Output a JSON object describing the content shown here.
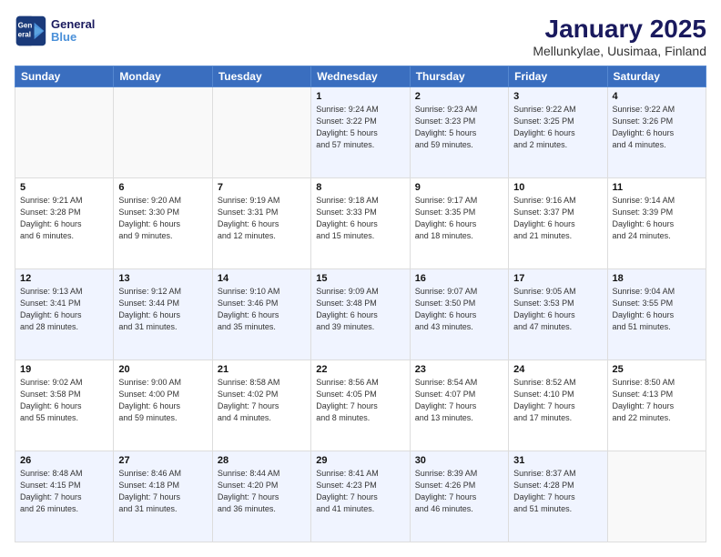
{
  "header": {
    "logo_line1": "General",
    "logo_line2": "Blue",
    "title": "January 2025",
    "subtitle": "Mellunkylae, Uusimaa, Finland"
  },
  "days_of_week": [
    "Sunday",
    "Monday",
    "Tuesday",
    "Wednesday",
    "Thursday",
    "Friday",
    "Saturday"
  ],
  "weeks": [
    [
      {
        "day": "",
        "info": ""
      },
      {
        "day": "",
        "info": ""
      },
      {
        "day": "",
        "info": ""
      },
      {
        "day": "1",
        "info": "Sunrise: 9:24 AM\nSunset: 3:22 PM\nDaylight: 5 hours\nand 57 minutes."
      },
      {
        "day": "2",
        "info": "Sunrise: 9:23 AM\nSunset: 3:23 PM\nDaylight: 5 hours\nand 59 minutes."
      },
      {
        "day": "3",
        "info": "Sunrise: 9:22 AM\nSunset: 3:25 PM\nDaylight: 6 hours\nand 2 minutes."
      },
      {
        "day": "4",
        "info": "Sunrise: 9:22 AM\nSunset: 3:26 PM\nDaylight: 6 hours\nand 4 minutes."
      }
    ],
    [
      {
        "day": "5",
        "info": "Sunrise: 9:21 AM\nSunset: 3:28 PM\nDaylight: 6 hours\nand 6 minutes."
      },
      {
        "day": "6",
        "info": "Sunrise: 9:20 AM\nSunset: 3:30 PM\nDaylight: 6 hours\nand 9 minutes."
      },
      {
        "day": "7",
        "info": "Sunrise: 9:19 AM\nSunset: 3:31 PM\nDaylight: 6 hours\nand 12 minutes."
      },
      {
        "day": "8",
        "info": "Sunrise: 9:18 AM\nSunset: 3:33 PM\nDaylight: 6 hours\nand 15 minutes."
      },
      {
        "day": "9",
        "info": "Sunrise: 9:17 AM\nSunset: 3:35 PM\nDaylight: 6 hours\nand 18 minutes."
      },
      {
        "day": "10",
        "info": "Sunrise: 9:16 AM\nSunset: 3:37 PM\nDaylight: 6 hours\nand 21 minutes."
      },
      {
        "day": "11",
        "info": "Sunrise: 9:14 AM\nSunset: 3:39 PM\nDaylight: 6 hours\nand 24 minutes."
      }
    ],
    [
      {
        "day": "12",
        "info": "Sunrise: 9:13 AM\nSunset: 3:41 PM\nDaylight: 6 hours\nand 28 minutes."
      },
      {
        "day": "13",
        "info": "Sunrise: 9:12 AM\nSunset: 3:44 PM\nDaylight: 6 hours\nand 31 minutes."
      },
      {
        "day": "14",
        "info": "Sunrise: 9:10 AM\nSunset: 3:46 PM\nDaylight: 6 hours\nand 35 minutes."
      },
      {
        "day": "15",
        "info": "Sunrise: 9:09 AM\nSunset: 3:48 PM\nDaylight: 6 hours\nand 39 minutes."
      },
      {
        "day": "16",
        "info": "Sunrise: 9:07 AM\nSunset: 3:50 PM\nDaylight: 6 hours\nand 43 minutes."
      },
      {
        "day": "17",
        "info": "Sunrise: 9:05 AM\nSunset: 3:53 PM\nDaylight: 6 hours\nand 47 minutes."
      },
      {
        "day": "18",
        "info": "Sunrise: 9:04 AM\nSunset: 3:55 PM\nDaylight: 6 hours\nand 51 minutes."
      }
    ],
    [
      {
        "day": "19",
        "info": "Sunrise: 9:02 AM\nSunset: 3:58 PM\nDaylight: 6 hours\nand 55 minutes."
      },
      {
        "day": "20",
        "info": "Sunrise: 9:00 AM\nSunset: 4:00 PM\nDaylight: 6 hours\nand 59 minutes."
      },
      {
        "day": "21",
        "info": "Sunrise: 8:58 AM\nSunset: 4:02 PM\nDaylight: 7 hours\nand 4 minutes."
      },
      {
        "day": "22",
        "info": "Sunrise: 8:56 AM\nSunset: 4:05 PM\nDaylight: 7 hours\nand 8 minutes."
      },
      {
        "day": "23",
        "info": "Sunrise: 8:54 AM\nSunset: 4:07 PM\nDaylight: 7 hours\nand 13 minutes."
      },
      {
        "day": "24",
        "info": "Sunrise: 8:52 AM\nSunset: 4:10 PM\nDaylight: 7 hours\nand 17 minutes."
      },
      {
        "day": "25",
        "info": "Sunrise: 8:50 AM\nSunset: 4:13 PM\nDaylight: 7 hours\nand 22 minutes."
      }
    ],
    [
      {
        "day": "26",
        "info": "Sunrise: 8:48 AM\nSunset: 4:15 PM\nDaylight: 7 hours\nand 26 minutes."
      },
      {
        "day": "27",
        "info": "Sunrise: 8:46 AM\nSunset: 4:18 PM\nDaylight: 7 hours\nand 31 minutes."
      },
      {
        "day": "28",
        "info": "Sunrise: 8:44 AM\nSunset: 4:20 PM\nDaylight: 7 hours\nand 36 minutes."
      },
      {
        "day": "29",
        "info": "Sunrise: 8:41 AM\nSunset: 4:23 PM\nDaylight: 7 hours\nand 41 minutes."
      },
      {
        "day": "30",
        "info": "Sunrise: 8:39 AM\nSunset: 4:26 PM\nDaylight: 7 hours\nand 46 minutes."
      },
      {
        "day": "31",
        "info": "Sunrise: 8:37 AM\nSunset: 4:28 PM\nDaylight: 7 hours\nand 51 minutes."
      },
      {
        "day": "",
        "info": ""
      }
    ]
  ]
}
